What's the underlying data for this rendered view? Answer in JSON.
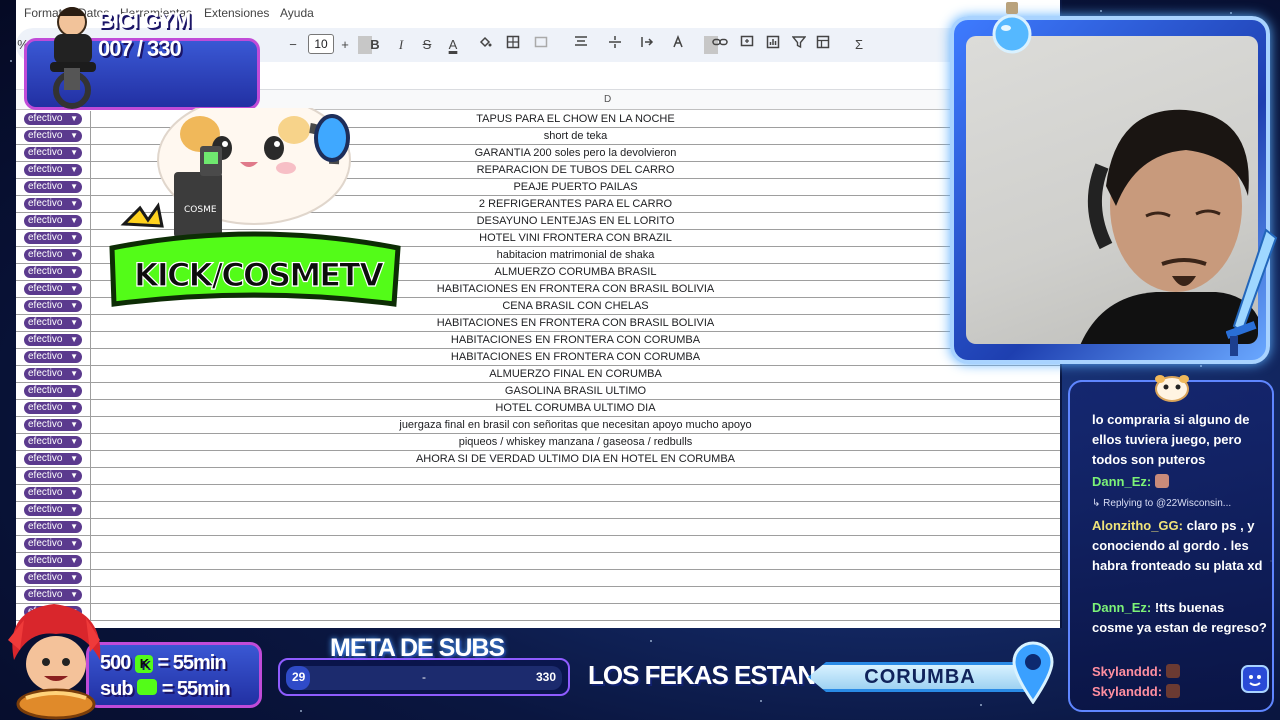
{
  "spreadsheet": {
    "menu": [
      "Formato",
      "Datos",
      "Herramientas",
      "Extensiones",
      "Ayuda"
    ],
    "toolbar": {
      "zoom": "%",
      "font_size": "10",
      "minus": "−",
      "plus": "+",
      "bold": "B",
      "italic": "I",
      "strike": "S",
      "text_color": "A",
      "sum": "Σ"
    },
    "column_header": "D",
    "payment_label": "efectivo",
    "rows": [
      "TAPUS PARA EL CHOW EN LA NOCHE",
      "short de teka",
      "GARANTIA 200 soles pero la devolvieron",
      "REPARACION DE TUBOS DEL CARRO",
      "PEAJE PUERTO PAILAS",
      "2 REFRIGERANTES PARA EL CARRO",
      "DESAYUNO LENTEJAS EN EL LORITO",
      "HOTEL VINI FRONTERA CON BRAZIL",
      "habitacion matrimonial de shaka",
      "ALMUERZO CORUMBA BRASIL",
      "HABITACIONES EN FRONTERA CON BRASIL BOLIVIA",
      "CENA BRASIL CON CHELAS",
      "HABITACIONES EN FRONTERA CON BRASIL BOLIVIA",
      "HABITACIONES EN FRONTERA CON CORUMBA",
      "HABITACIONES EN FRONTERA CON CORUMBA",
      "ALMUERZO FINAL EN CORUMBA",
      "GASOLINA BRASIL ULTIMO",
      "HOTEL CORUMBA ULTIMO DIA",
      "juergaza final en brasil con señoritas que necesitan apoyo mucho apoyo",
      "piqueos / whiskey manzana / gaseosa / redbulls",
      "AHORA SI DE VERDAD ULTIMO DIA EN HOTEL EN CORUMBA",
      "",
      "",
      "",
      "",
      "",
      "",
      "",
      "",
      ""
    ]
  },
  "overlay": {
    "bici_gym": {
      "title": "BICI GYM",
      "count": "007 / 330"
    },
    "subs": {
      "line1_amount": "500",
      "line1_value": "= 55min",
      "line2_amount": "sub",
      "line2_value": "= 55min"
    },
    "meta": {
      "title": "META DE SUBS",
      "start": "29",
      "separator": "-",
      "goal": "330"
    },
    "location": {
      "label": "LOS FEKAS ESTAN EN:",
      "value": "CORUMBA"
    },
    "kick_logo_text": "KICK/COSMETV",
    "mascot_badge": "COSME"
  },
  "chat": [
    {
      "user": "",
      "text": "lo compraria si alguno de ellos tuviera juego, pero todos son puteros"
    },
    {
      "user": "Dann_Ez:",
      "text": ""
    },
    {
      "reply": "↳ Replying to @22Wisconsin..."
    },
    {
      "user": "Alonzitho_GG:",
      "text": " claro ps , y conociendo al gordo . les habra fronteado su plata xd"
    },
    {
      "user": "Dann_Ez:",
      "text": " !tts buenas cosme ya estan de regreso?"
    },
    {
      "user": "Skylanddd:",
      "text": ""
    },
    {
      "user": "Skylanddd:",
      "text": ""
    }
  ],
  "colors": {
    "pill": "#5b3a8e",
    "panel_border": "#c04bd8",
    "chat_green": "#7cf277",
    "chat_yellow": "#f0e37a",
    "chat_pink": "#ff8fa0",
    "location_bg": "#d8f2ff"
  }
}
